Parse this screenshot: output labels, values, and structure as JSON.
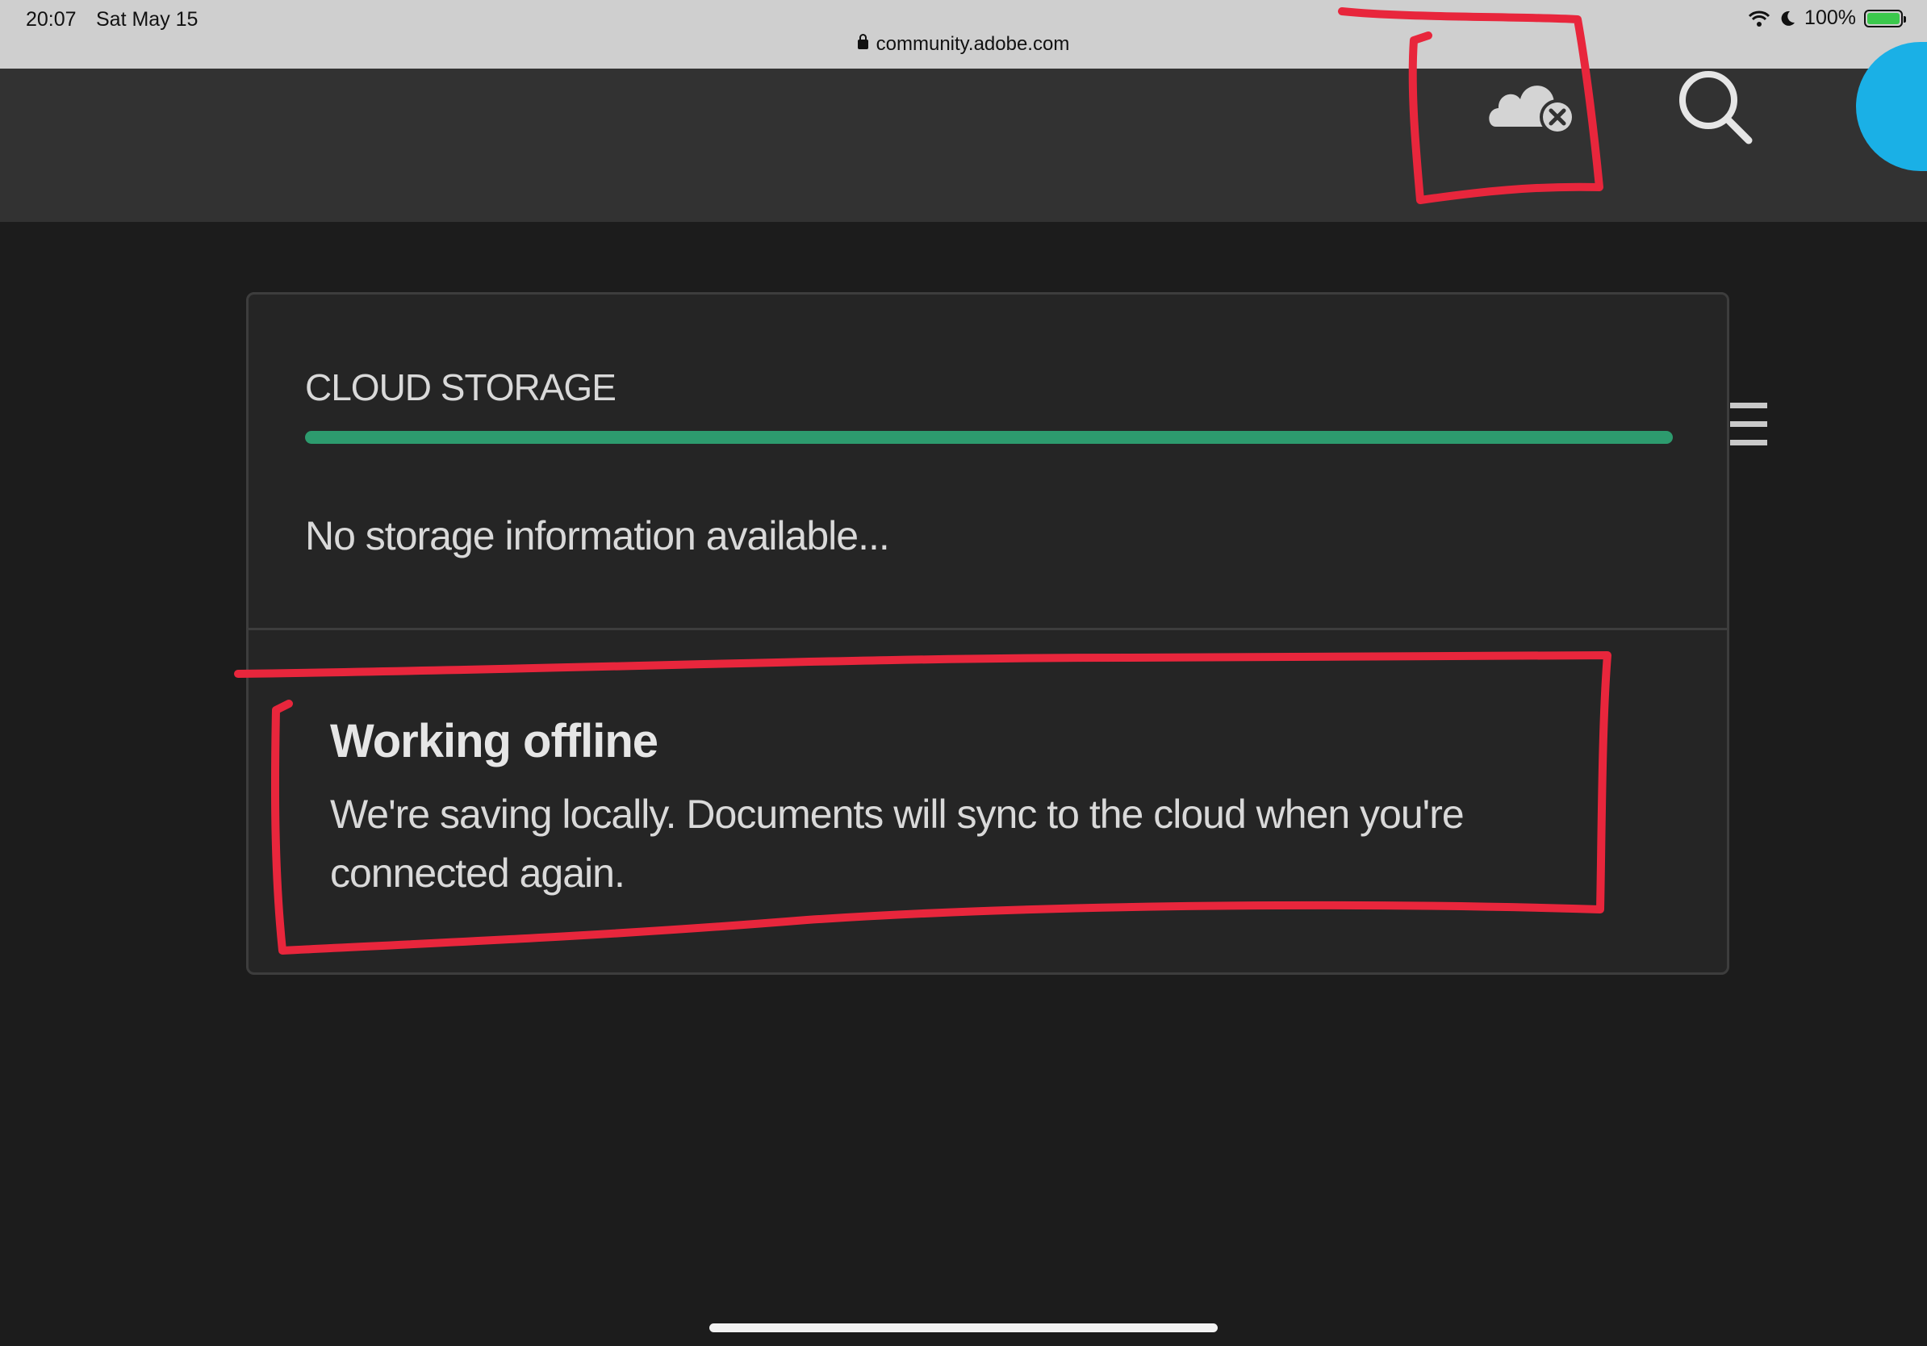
{
  "status_bar": {
    "time": "20:07",
    "date": "Sat May 15",
    "url": "community.adobe.com",
    "battery": "100%"
  },
  "header": {
    "icons": [
      "cloud-offline-icon",
      "search-icon",
      "avatar"
    ]
  },
  "panel": {
    "title": "CLOUD STORAGE",
    "storage_fill": 1.0,
    "storage_info": "No storage information available...",
    "offline_title": "Working offline",
    "offline_text": "We're saving locally. Documents will sync to the cloud when you're connected again."
  },
  "colors": {
    "progress": "#2d9b6e",
    "annotation": "#e8263c",
    "avatar": "#1ab0e6"
  }
}
